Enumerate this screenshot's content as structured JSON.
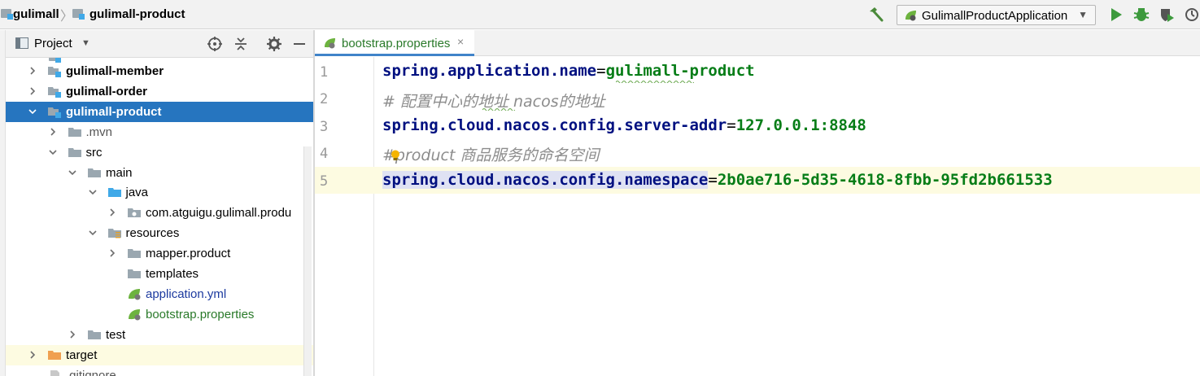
{
  "breadcrumb": {
    "project": "gulimall",
    "module": "gulimall-product"
  },
  "toolbar": {
    "run_config": "GulimallProductApplication"
  },
  "project_panel": {
    "title": "Project"
  },
  "tree": [
    {
      "label": "gulimall-member",
      "style": "bold",
      "icon": "module-icon",
      "expand": "collapsed"
    },
    {
      "label": "gulimall-order",
      "style": "bold",
      "icon": "module-icon",
      "expand": "collapsed"
    },
    {
      "label": "gulimall-product",
      "style": "bold",
      "icon": "module-icon",
      "expand": "expanded",
      "selected": true
    },
    {
      "label": ".mvn",
      "style": "gray",
      "icon": "folder-icon",
      "expand": "collapsed"
    },
    {
      "label": "src",
      "style": "normal",
      "icon": "folder-icon",
      "expand": "expanded"
    },
    {
      "label": "main",
      "style": "normal",
      "icon": "folder-icon",
      "expand": "expanded"
    },
    {
      "label": "java",
      "style": "normal",
      "icon": "source-folder-icon",
      "expand": "expanded"
    },
    {
      "label": "com.atguigu.gulimall.produ",
      "style": "normal",
      "icon": "package-icon",
      "expand": "collapsed"
    },
    {
      "label": "resources",
      "style": "normal",
      "icon": "resources-folder-icon",
      "expand": "expanded"
    },
    {
      "label": "mapper.product",
      "style": "normal",
      "icon": "folder-icon",
      "expand": "collapsed"
    },
    {
      "label": "templates",
      "style": "normal",
      "icon": "folder-icon",
      "expand": "none"
    },
    {
      "label": "application.yml",
      "style": "blue",
      "icon": "spring-yml-icon",
      "expand": "none"
    },
    {
      "label": "bootstrap.properties",
      "style": "green",
      "icon": "spring-properties-icon",
      "expand": "none"
    },
    {
      "label": "test",
      "style": "normal",
      "icon": "folder-icon",
      "expand": "collapsed"
    },
    {
      "label": "target",
      "style": "normal",
      "icon": "excluded-folder-icon",
      "expand": "collapsed"
    },
    {
      "label": ".gitignore",
      "style": "gray",
      "icon": "file-icon",
      "expand": "none"
    }
  ],
  "editor": {
    "tab": {
      "label": "bootstrap.properties",
      "close": "×"
    },
    "line_numbers": [
      "1",
      "2",
      "3",
      "4",
      "5"
    ],
    "lines": [
      {
        "key": "spring.application.name",
        "eq": "=",
        "value": "gulimall-product"
      },
      {
        "comment": "# 配置中心的地址 nacos的地址"
      },
      {
        "key": "spring.cloud.nacos.config.server-addr",
        "eq": "=",
        "value": "127.0.0.1:8848"
      },
      {
        "hash": "#",
        "comment_rest": "product 商品服务的命名空间"
      },
      {
        "key": "spring.cloud.nacos.config.namespace",
        "eq": "=",
        "value": "2b0ae716-5d35-4618-8fbb-95fd2b661533"
      }
    ]
  },
  "colors": {
    "selection": "#2675bf",
    "property_key": "#001080",
    "property_value": "#067d17",
    "comment": "#8c8c8c",
    "current_line": "#fdfbe1",
    "tab_underline": "#4083c9"
  }
}
